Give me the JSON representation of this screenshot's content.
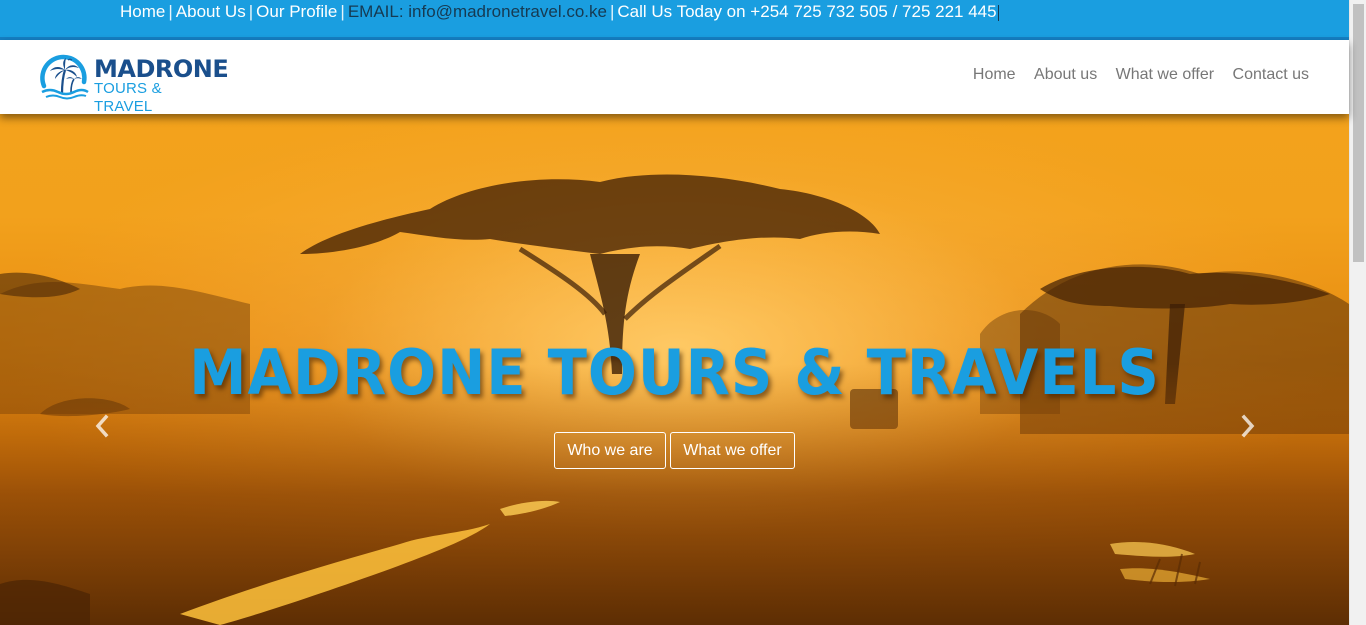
{
  "topbar": {
    "home": "Home",
    "about": "About Us",
    "profile": "Our Profile",
    "email": "EMAIL: info@madronetravel.co.ke",
    "call": "Call Us Today on +254 725 732 505 / 725 221 445",
    "separator": "|"
  },
  "brand": {
    "title": "MADRONE",
    "subtitle": "TOURS & TRAVEL",
    "logo_icon": "palm-beach-logo-icon"
  },
  "nav": {
    "items": [
      {
        "label": "Home"
      },
      {
        "label": "About us"
      },
      {
        "label": "What we offer"
      },
      {
        "label": "Contact us"
      }
    ]
  },
  "hero": {
    "title": "MADRONE TOURS & TRAVELS",
    "buttons": {
      "who": "Who we are",
      "what": "What we offer"
    },
    "prev_icon": "chevron-left-icon",
    "next_icon": "chevron-right-icon"
  },
  "colors": {
    "accent": "#1a9ee0",
    "brand_dark": "#1a4f8c",
    "nav_text": "#777777"
  }
}
